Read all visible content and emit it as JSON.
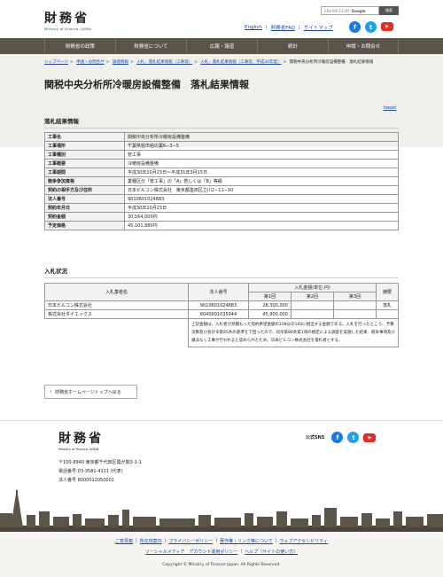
{
  "header": {
    "logo_kanji": "財務省",
    "logo_en": "Ministry of Finance, JAPAN",
    "search_placeholder": "ENHANCED BY",
    "search_google": "Google",
    "search_button": "検索",
    "links": [
      "English",
      "財務省FAQ",
      "サイトマップ"
    ]
  },
  "nav": [
    "財務省の政策",
    "財務省について",
    "広報・報道",
    "統計",
    "申請・お問合せ"
  ],
  "breadcrumb": [
    "トップページ",
    "申請・お問合せ",
    "調達情報",
    "入札、落札結果情報（工事等）",
    "入札、落札結果情報（工事等：平成30年度）",
    "関税中央分析所冷暖房設備整備　落札結果情報"
  ],
  "page_title": "関税中央分析所冷暖房設備整備　落札結果情報",
  "tweet": "tweet",
  "section1_title": "落札結果情報",
  "result_rows": [
    {
      "k": "工事名",
      "v": "関税中央分析所冷暖房設備整備"
    },
    {
      "k": "工事場所",
      "v": "千葉県柏市柏の葉6−3−5"
    },
    {
      "k": "工事種別",
      "v": "管工事"
    },
    {
      "k": "工事概要",
      "v": "冷暖房設備整備"
    },
    {
      "k": "工事期間",
      "v": "平成30年10月23日～平成31年3月15日"
    },
    {
      "k": "競争参加資格",
      "v": "業種区分「管工事」の「A」若しくは「B」等級"
    },
    {
      "k": "契約の相手方及び住所",
      "v": "日本ビルコン株式会社　東京都墨田区立川2−11−10"
    },
    {
      "k": "法人番号",
      "v": "9010601024883"
    },
    {
      "k": "契約年月日",
      "v": "平成30年10月23日"
    },
    {
      "k": "契約金額",
      "v": "30,564,000円"
    },
    {
      "k": "予定価格",
      "v": "45,101,880円"
    }
  ],
  "section2_title": "入札状況",
  "bid_headers": {
    "name": "入札業者名",
    "corp": "法人番号",
    "amount": "入札金額(単位:円)",
    "r1": "第1回",
    "r2": "第2回",
    "r3": "第3回",
    "remark": "摘要"
  },
  "bids": [
    {
      "name": "日本ビルコン株式会社",
      "corp": "9010601024883",
      "r1": "28,300,000",
      "r2": "",
      "r3": "",
      "remark": "落札"
    },
    {
      "name": "株式会社ダイエックス",
      "corp": "6040001035944",
      "r1": "45,900,000",
      "r2": "",
      "r3": "",
      "remark": ""
    }
  ],
  "bid_note": "上記金額は、入札者が見積もった契約希望金額の108分の100に相当する金額である。入札を行ったところ、予算決算及び会計令第85条の基準を下回ったので、同令第86条第1項の規定による調査を実施した結果、競争事項及び遵法なく工事が行われると認められたため、日本ビルコン株式会社を落札者とする。",
  "back_button": "財務省ホームページトップへ戻る",
  "footer": {
    "logo_kanji": "財務省",
    "logo_en": "Ministry of Finance, JAPAN",
    "social_label": "公式SNS",
    "address": [
      "〒100-8940 東京都千代田区霞が関3-1-1",
      "電話番号:03-3581-4111 (代表)",
      "法人番号 8000012050001"
    ],
    "links_row1": [
      "ご意見箱",
      "所在地案内",
      "プライバシーポリシー",
      "著作権・リンク等について",
      "ウェブアクセシビリティ"
    ],
    "links_row2": [
      "ソーシャルメディア　アカウント運用ポリシー",
      "ヘルプ（サイトの使い方）"
    ],
    "copyright": "Copyright © Ministry of Finance Japan. All Rights Reserved."
  }
}
